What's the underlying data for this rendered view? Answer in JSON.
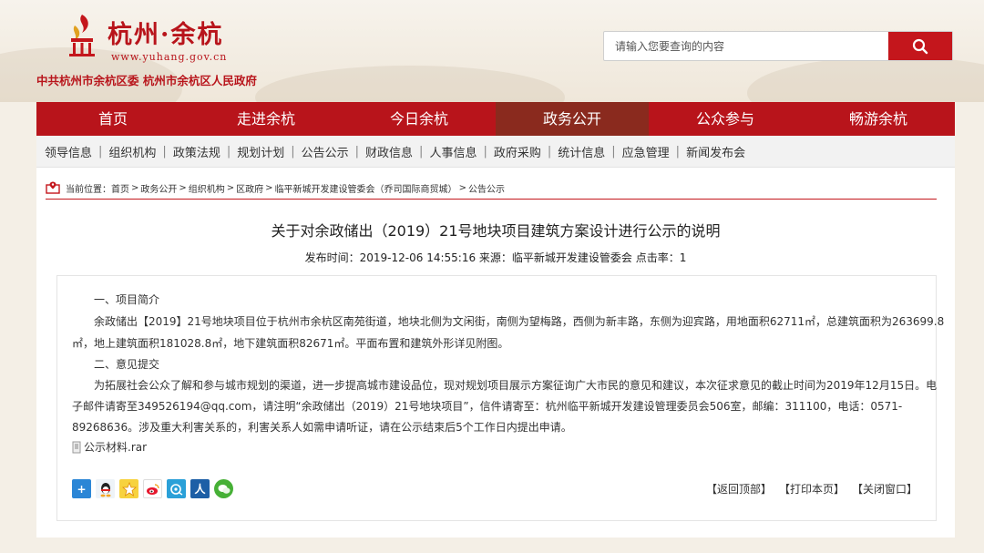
{
  "header": {
    "logo_title": "杭州·余杭",
    "logo_url": "www.yuhang.gov.cn",
    "org_line": "中共杭州市余杭区委  杭州市余杭区人民政府",
    "search_placeholder": "请输入您要查询的内容"
  },
  "nav": [
    "首页",
    "走进余杭",
    "今日余杭",
    "政务公开",
    "公众参与",
    "畅游余杭"
  ],
  "nav_active": "政务公开",
  "subnav": [
    "领导信息",
    "组织机构",
    "政策法规",
    "规划计划",
    "公告公示",
    "财政信息",
    "人事信息",
    "政府采购",
    "统计信息",
    "应急管理",
    "新闻发布会"
  ],
  "breadcrumb": {
    "prefix": "当前位置：",
    "items": [
      "首页",
      "政务公开",
      "组织机构",
      "区政府",
      "临平新城开发建设管委会（乔司国际商贸城）",
      "公告公示"
    ]
  },
  "article": {
    "title": "关于对余政储出（2019）21号地块项目建筑方案设计进行公示的说明",
    "meta": "发布时间：2019-12-06 14:55:16 来源：临平新城开发建设管委会 点击率：1",
    "section1_heading": "一、项目简介",
    "p1_line1": "余政储出【2019】21号地块项目位于杭州市余杭区南苑街道，地块北侧为文闲街，南侧为望梅路，西侧为新丰路，东侧为迎宾路，用地面积62711㎡，总建筑面积为263699.8",
    "p1_line2": "㎡，地上建筑面积181028.8㎡，地下建筑面积82671㎡。平面布置和建筑外形详见附图。",
    "section2_heading": "二、意见提交",
    "p2_line1": "为拓展社会公众了解和参与城市规划的渠道，进一步提高城市建设品位，现对规划项目展示方案征询广大市民的意见和建议，本次征求意见的截止时间为2019年12月15日。电",
    "p2_line2": "子邮件请寄至349526194@qq.com，请注明“余政储出（2019）21号地块项目”，信件请寄至：杭州临平新城开发建设管理委员会506室，邮编：311100，电话：0571-",
    "p2_line3": "89268636。涉及重大利害关系的，利害关系人如需申请听证，请在公示结束后5个工作日内提出申请。",
    "attachment": "公示材料.rar"
  },
  "share_icons": [
    "plus-share-icon",
    "qq-icon",
    "qzone-star-icon",
    "weibo-icon",
    "tencent-weibo-icon",
    "renren-icon",
    "wechat-icon"
  ],
  "footer_links": [
    "【返回顶部】",
    "【打印本页】",
    "【关闭窗口】"
  ],
  "colors": {
    "brand_red": "#b8141b",
    "nav_active": "#8a2a1e",
    "page_bg": "#f4efe6"
  }
}
